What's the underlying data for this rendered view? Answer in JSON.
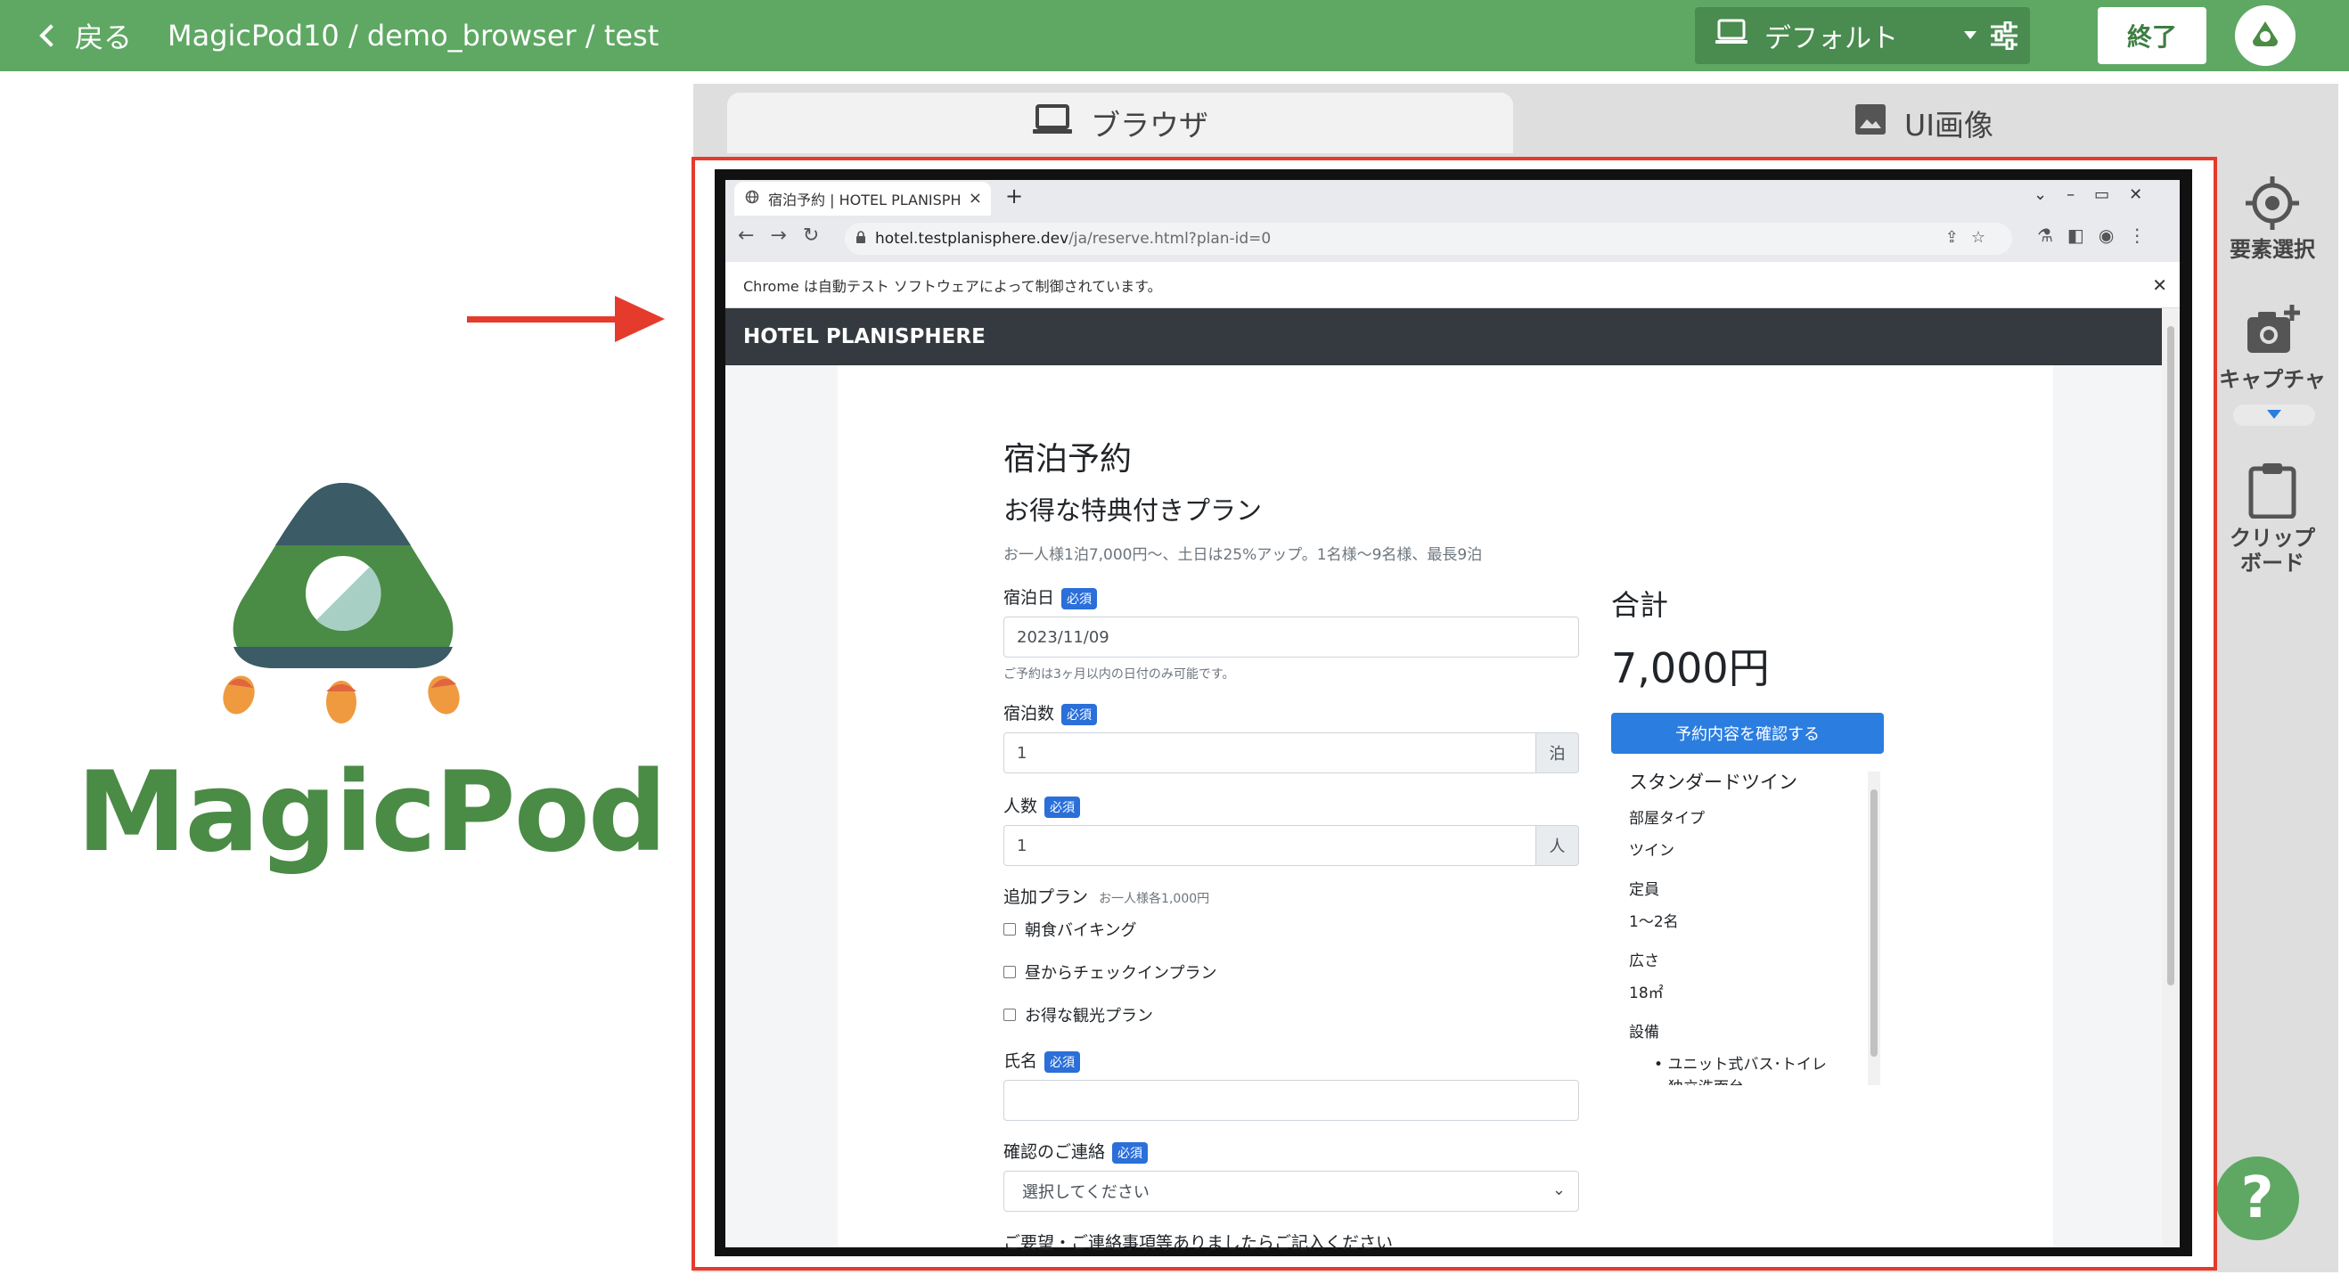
{
  "app": {
    "back_label": "戻る",
    "breadcrumb": "MagicPod10 / demo_browser / test",
    "device_value": "デフォルト",
    "end_label": "終了",
    "logo_text": "MagicPod"
  },
  "tabs": {
    "browser": "ブラウザ",
    "ui_image": "UI画像"
  },
  "tools": {
    "select": "要素選択",
    "capture": "キャプチャ",
    "clipboard_line1": "クリップ",
    "clipboard_line2": "ボード",
    "help": "?"
  },
  "browser": {
    "tab_title": "宿泊予約 | HOTEL PLANISPH",
    "url_host": "hotel.testplanisphere.dev",
    "url_path": "/ja/reserve.html?plan-id=0",
    "infobar": "Chrome は自動テスト ソフトウェアによって制御されています。"
  },
  "site": {
    "brand": "HOTEL PLANISPHERE",
    "title": "宿泊予約",
    "plan_name": "お得な特典付きプラン",
    "plan_desc": "お一人様1泊7,000円〜、土日は25%アップ。1名様〜9名様、最長9泊",
    "required": "必須",
    "date_label": "宿泊日",
    "date_value": "2023/11/09",
    "date_hint": "ご予約は3ヶ月以内の日付のみ可能です。",
    "nights_label": "宿泊数",
    "nights_value": "1",
    "nights_unit": "泊",
    "guests_label": "人数",
    "guests_value": "1",
    "guests_unit": "人",
    "addon_label": "追加プラン",
    "addon_note": "お一人様各1,000円",
    "addon_1": "朝食バイキング",
    "addon_2": "昼からチェックインプラン",
    "addon_3": "お得な観光プラン",
    "name_label": "氏名",
    "contact_label": "確認のご連絡",
    "contact_value": "選択してください",
    "notes_label": "ご要望・ご連絡事項等ありましたらご記入ください",
    "total_label": "合計",
    "total_value": "7,000円",
    "confirm_button": "予約内容を確認する",
    "room_name": "スタンダードツイン",
    "room_type_label": "部屋タイプ",
    "room_type_value": "ツイン",
    "capacity_label": "定員",
    "capacity_value": "1〜2名",
    "size_label": "広さ",
    "size_value": "18㎡",
    "facilities_label": "設備",
    "facility_1": "ユニット式バス･トイレ",
    "facility_2": "独立洗面台"
  }
}
